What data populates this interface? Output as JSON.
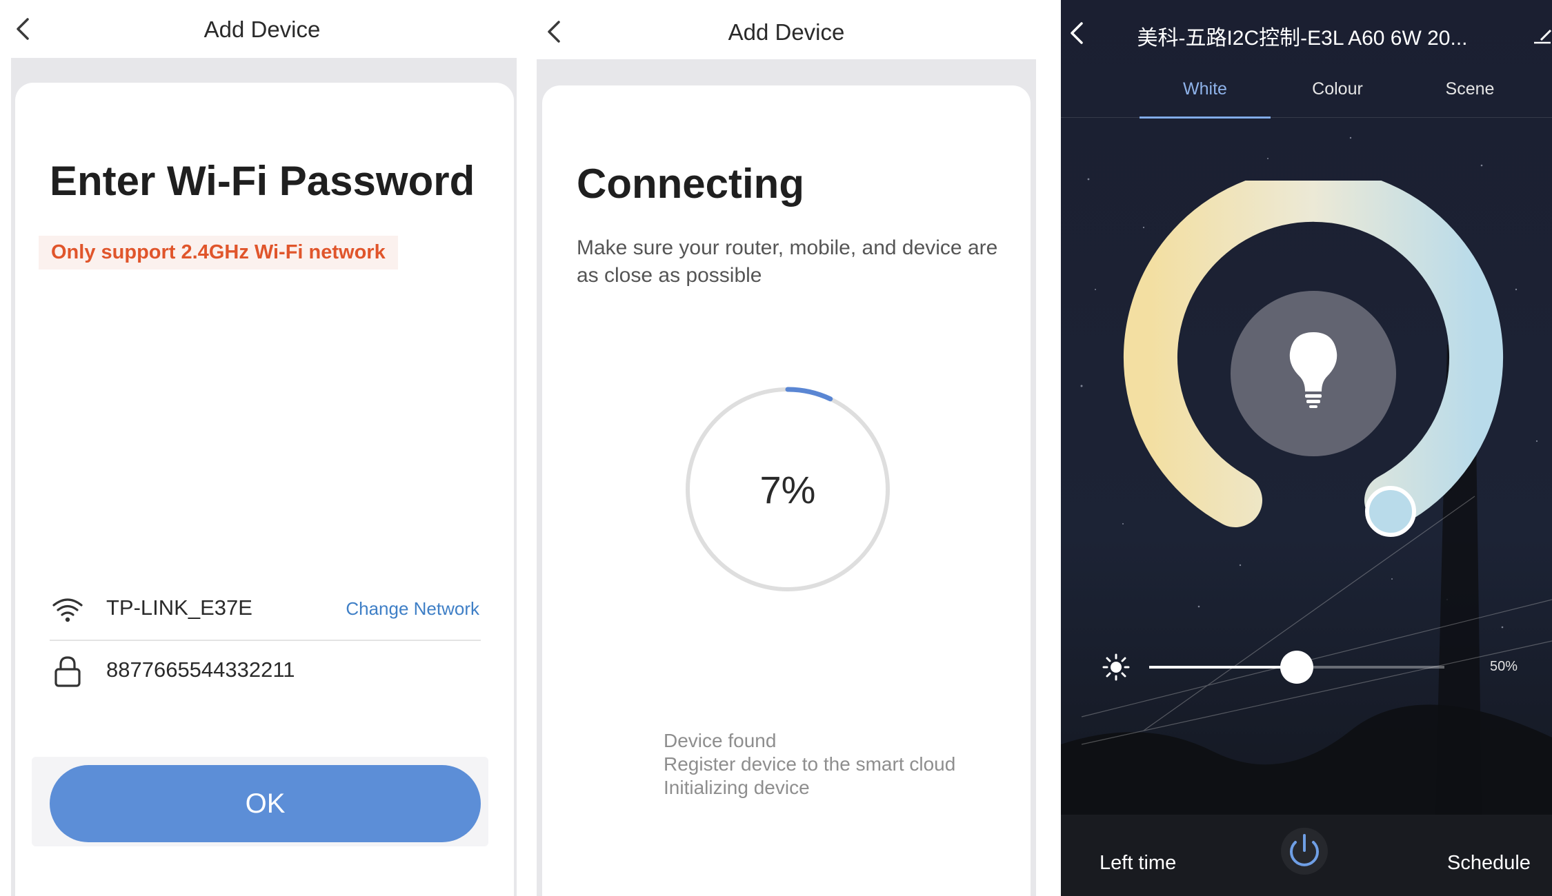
{
  "panel1": {
    "nav_title": "Add Device",
    "heading": "Enter Wi-Fi Password",
    "warning": "Only support 2.4GHz Wi-Fi network",
    "network_name": "TP-LINK_E37E",
    "change_network": "Change Network",
    "password": "8877665544332211",
    "ok_label": "OK",
    "colors": {
      "button": "#5c8ed7",
      "warning": "#e0552b",
      "link": "#3f7fc6"
    }
  },
  "panel2": {
    "nav_title": "Add Device",
    "heading": "Connecting",
    "description": "Make sure your router, mobile, and device are as close as possible",
    "progress_label": "7%",
    "progress": 0.07,
    "steps": [
      "Device found",
      "Register device to the smart cloud",
      "Initializing device"
    ]
  },
  "panel3": {
    "device_title": "美科-五路I2C控制-E3L A60 6W 20...",
    "tabs": [
      {
        "label": "White",
        "active": true
      },
      {
        "label": "Colour",
        "active": false
      },
      {
        "label": "Scene",
        "active": false
      }
    ],
    "brightness_label": "50%",
    "brightness": 0.5,
    "left_time": "Left time",
    "schedule": "Schedule",
    "icons": [
      "back-icon",
      "edit-icon",
      "bulb-icon",
      "sun-icon",
      "power-icon"
    ]
  }
}
